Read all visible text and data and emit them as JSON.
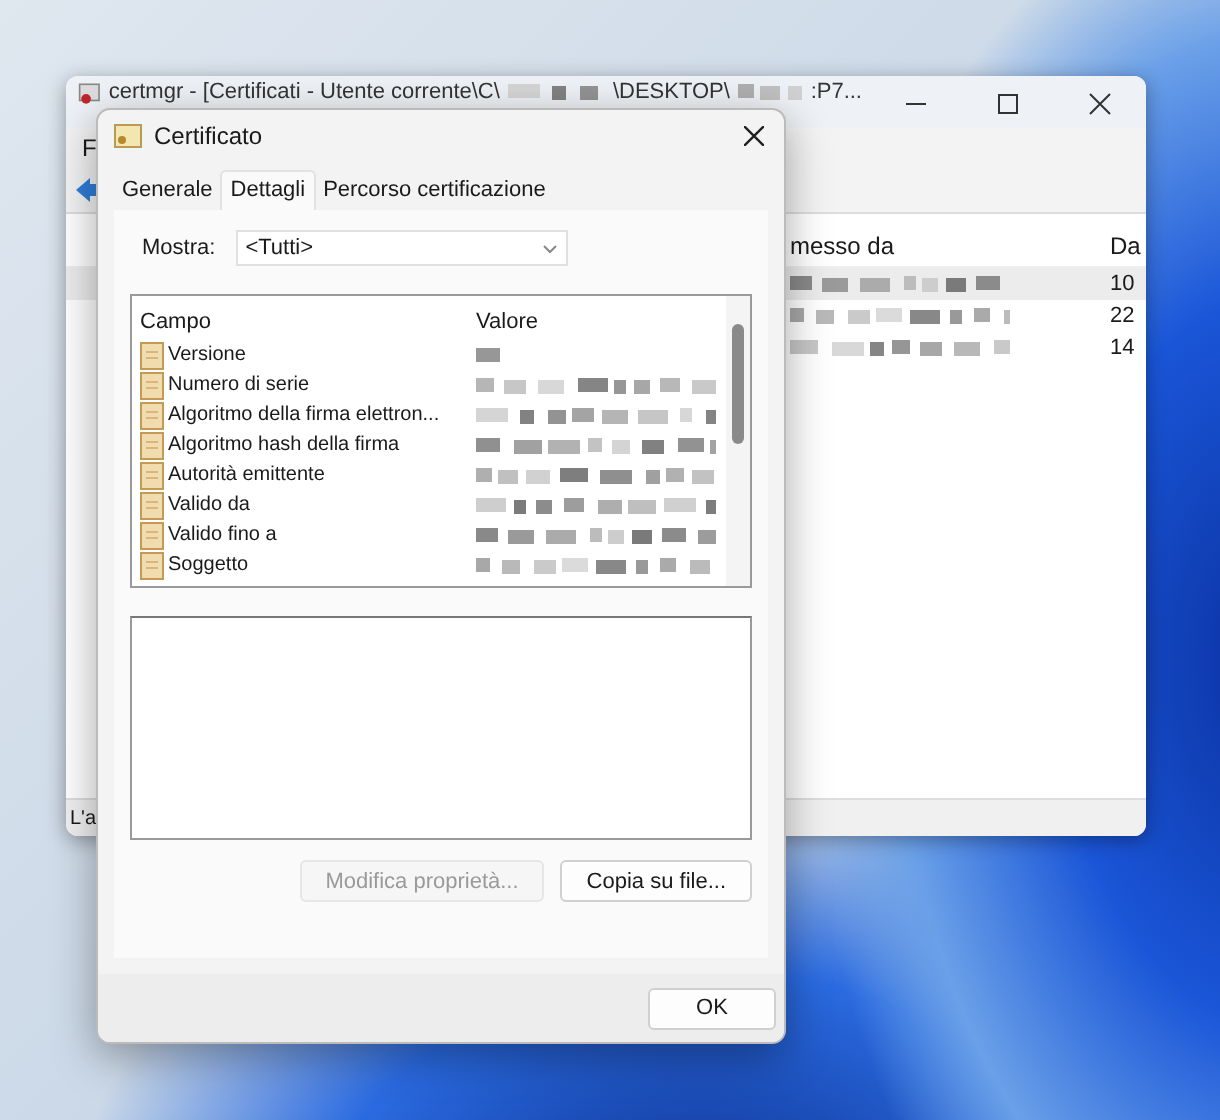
{
  "background_window": {
    "title": "certmgr - [Certificati - Utente corrente\\C\\",
    "title_middle": "\\DESKTOP\\",
    "title_end": ":P7...",
    "menu": [
      "F"
    ],
    "columns": [
      {
        "label": "messo da"
      },
      {
        "label": "Da"
      }
    ],
    "rows": [
      {
        "column_2": "10",
        "selected": true
      },
      {
        "column_2": "22",
        "selected": false
      },
      {
        "column_2": "14",
        "selected": false
      }
    ],
    "status_bar": "L'a"
  },
  "dialog": {
    "title": "Certificato",
    "tabs": [
      {
        "label": "Generale",
        "selected": false
      },
      {
        "label": "Dettagli",
        "selected": true
      },
      {
        "label": "Percorso certificazione",
        "selected": false
      }
    ],
    "show_label": "Mostra:",
    "show_value": "<Tutti>",
    "columns": [
      "Campo",
      "Valore"
    ],
    "fields": [
      {
        "name": "Versione"
      },
      {
        "name": "Numero di serie"
      },
      {
        "name": "Algoritmo della firma elettron..."
      },
      {
        "name": "Algoritmo hash della firma"
      },
      {
        "name": "Autorità emittente"
      },
      {
        "name": "Valido da"
      },
      {
        "name": "Valido fino a"
      },
      {
        "name": "Soggetto"
      }
    ],
    "buttons": [
      {
        "label": "Modifica proprietà...",
        "disabled": true
      },
      {
        "label": "Copia su file...",
        "disabled": false
      }
    ],
    "ok_button": "OK"
  }
}
